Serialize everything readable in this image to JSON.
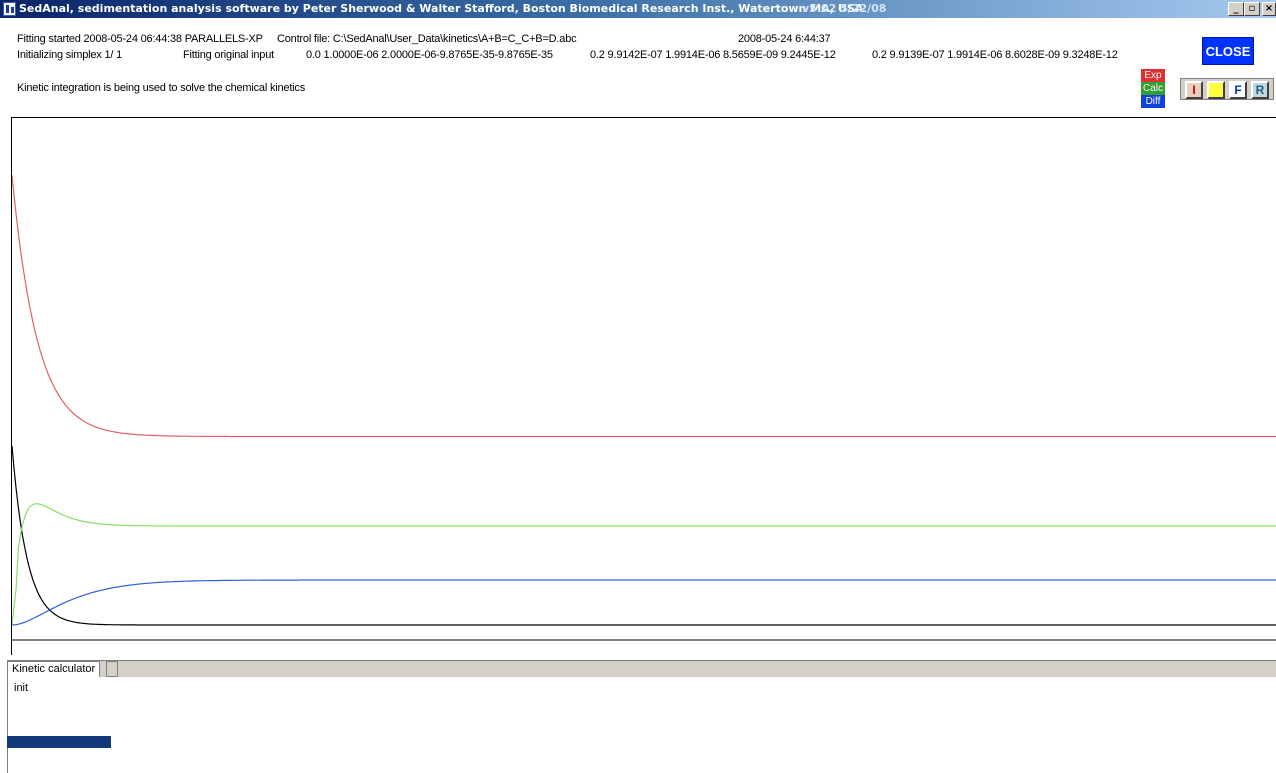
{
  "window": {
    "title": "SedAnal, sedimentation analysis software by Peter Sherwood & Walter Stafford, Boston Biomedical Research Inst., Watertown MA, USA",
    "version": "v5.02  5/22/08",
    "controls": {
      "minimize": "_",
      "maximize": "▫",
      "close": "×"
    }
  },
  "status": {
    "fitting_started": "Fitting started 2008-05-24  06:44:38  PARALLELS-XP",
    "control_file": "Control file: C:\\SedAnal\\User_Data\\kinetics\\A+B=C_C+B=D.abc",
    "timestamp": "2008-05-24   6:44:37",
    "initializing": "Initializing simplex 1/ 1",
    "fitting_input": "Fitting original input",
    "params_1": "0.0 1.0000E-06 2.0000E-06-9.8765E-35-9.8765E-35",
    "params_2": "0.2 9.9142E-07 1.9914E-06 8.5659E-09 9.2445E-12",
    "params_3": "0.2 9.9139E-07 1.9914E-06 8.6028E-09 9.3248E-12",
    "kinetic_message": "Kinetic integration is being used to solve the chemical kinetics"
  },
  "close_button": "CLOSE",
  "legend": [
    {
      "label": "Exp",
      "color": "#e03030"
    },
    {
      "label": "Calc",
      "color": "#30a030"
    },
    {
      "label": "Diff",
      "color": "#1040e0"
    }
  ],
  "tools": [
    {
      "label": "I",
      "bg": "#e8d0c0",
      "fg": "#cc0000",
      "icon": "i-icon"
    },
    {
      "label": "",
      "bg": "#ffff40",
      "fg": "#000000",
      "icon": "yellow-square-icon"
    },
    {
      "label": "F",
      "bg": "#ffffff",
      "fg": "#0030c0",
      "icon": "f-icon"
    },
    {
      "label": "R",
      "bg": "#c0d8e0",
      "fg": "#206080",
      "icon": "r-icon"
    }
  ],
  "chart_data": {
    "type": "line",
    "title": "",
    "xlabel": "",
    "ylabel": "",
    "grid": false,
    "xlim": [
      0,
      1
    ],
    "ylim": [
      0,
      1
    ],
    "series": [
      {
        "color": "#e06060",
        "start": 0.93,
        "end": 0.407,
        "tau": 0.02,
        "shape": "decay"
      },
      {
        "color": "#000000",
        "start": 0.388,
        "end": 0.03,
        "tau": 0.012,
        "shape": "decay"
      },
      {
        "color": "#80e060",
        "start": 0.03,
        "end": 0.228,
        "tau": 0.012,
        "peak": 0.272,
        "shape": "overshoot"
      },
      {
        "color": "#3060e0",
        "start": 0.03,
        "end": 0.12,
        "tau": 0.025,
        "shape": "rise"
      }
    ]
  },
  "panel": {
    "tab_label": "Kinetic calculator",
    "content": "init"
  }
}
